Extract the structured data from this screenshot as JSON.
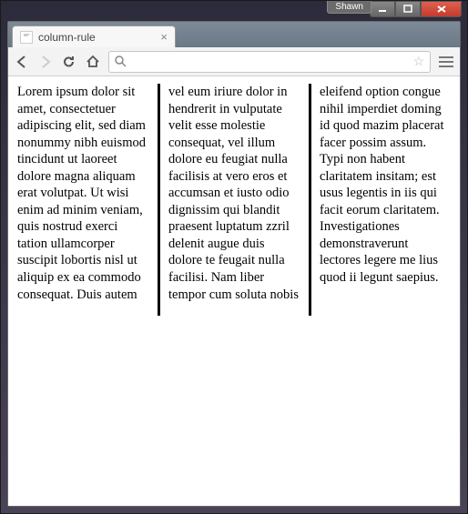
{
  "os": {
    "user_badge": "Shawn"
  },
  "browser": {
    "tab": {
      "title": "column-rule"
    },
    "omnibox": {
      "value": "",
      "placeholder": ""
    }
  },
  "page": {
    "body_text": "Lorem ipsum dolor sit amet, consectetuer adipiscing elit, sed diam nonummy nibh euismod tincidunt ut laoreet dolore magna aliquam erat volutpat. Ut wisi enim ad minim veniam, quis nostrud exerci tation ullamcorper suscipit lobortis nisl ut aliquip ex ea commodo consequat. Duis autem vel eum iriure dolor in hendrerit in vulputate velit esse molestie consequat, vel illum dolore eu feugiat nulla facilisis at vero eros et accumsan et iusto odio dignissim qui blandit praesent luptatum zzril delenit augue duis dolore te feugait nulla facilisi. Nam liber tempor cum soluta nobis eleifend option congue nihil imperdiet doming id quod mazim placerat facer possim assum. Typi non habent claritatem insitam; est usus legentis in iis qui facit eorum claritatem. Investigationes demonstraverunt lectores legere me lius quod ii legunt saepius.",
    "columns": 3,
    "column_rule": "3px solid #000"
  }
}
